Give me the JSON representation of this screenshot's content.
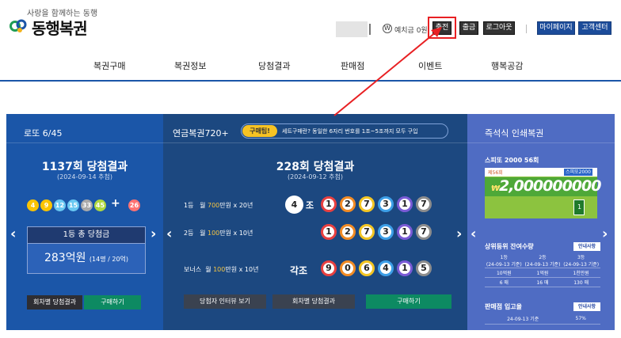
{
  "header": {
    "logo_sub": "사랑을 함께하는 동행",
    "logo_title": "동행복권",
    "deposit_icon": "W",
    "deposit_label": "예치금 0원",
    "charge": "충전",
    "withdraw": "출금",
    "logout": "로그아웃",
    "mypage": "마이페이지",
    "support": "고객센터",
    "highlight_color": "#e82023"
  },
  "nav": [
    "복권구매",
    "복권정보",
    "당첨결과",
    "판매점",
    "이벤트",
    "행복공감"
  ],
  "lotto": {
    "title": "로또 6/45",
    "round": "1137회 당첨결과",
    "date": "(2024-09-14 추첨)",
    "balls": [
      {
        "n": "4",
        "color": "#fbc400"
      },
      {
        "n": "9",
        "color": "#fbc400"
      },
      {
        "n": "12",
        "color": "#69c8f2"
      },
      {
        "n": "15",
        "color": "#69c8f2"
      },
      {
        "n": "33",
        "color": "#aaaaaa"
      },
      {
        "n": "45",
        "color": "#b0d840"
      }
    ],
    "plus": "+",
    "bonus": {
      "n": "26",
      "color": "#ff7272"
    },
    "prize_label": "1등 총 당첨금",
    "amount": "283억원",
    "amount_detail": "(14명 / 20억)",
    "btn_results": "회차별 당첨결과",
    "btn_buy": "구매하기"
  },
  "pension": {
    "title": "연금복권720+",
    "tip_tag": "구매팁!",
    "tip_text": "세트구매란? 동일한 6자리 번호를 1조~5조까지 모두 구입",
    "round": "228회 당첨결과",
    "date": "(2024-09-12 추첨)",
    "rank1": {
      "rank": "1등",
      "pre": "월 ",
      "amt": "700",
      "post": "만원 x 20년"
    },
    "rank2": {
      "rank": "2등",
      "pre": "월 ",
      "amt": "100",
      "post": "만원 x 10년"
    },
    "rank_bonus": {
      "rank": "보너스",
      "pre": "월 ",
      "amt": "100",
      "post": "만원 x 10년"
    },
    "jo_num": "4",
    "jo": "조",
    "gakjo": "각조",
    "digits1": [
      "1",
      "2",
      "7",
      "3",
      "1",
      "7"
    ],
    "digits2": [
      "1",
      "2",
      "7",
      "3",
      "1",
      "7"
    ],
    "digits_bonus": [
      "9",
      "0",
      "6",
      "4",
      "1",
      "5"
    ],
    "digit_colors": [
      "#e94040",
      "#f28b24",
      "#f3c523",
      "#3d9fe8",
      "#7a5bd6",
      "#8d8d8d"
    ],
    "btn_review": "당첨자 인터뷰 보기",
    "btn_results": "회차별 당첨결과",
    "btn_buy": "구매하기"
  },
  "instant": {
    "title": "즉석식 인쇄복권",
    "product": "스피또 2000 56회",
    "ticket_no": "제56회",
    "ticket_brand": "스피또2000",
    "ticket_amount": "2,000000000",
    "ticket_prefix": "₩",
    "ticket_box": "1",
    "remain_title": "상위등위 잔여수량",
    "remain_help": "안내사항",
    "cols": [
      "1등",
      "2등",
      "3등"
    ],
    "cols_date": [
      "(24-09-13 기준)",
      "(24-09-13 기준)",
      "(24-09-13 기준)"
    ],
    "prizes": [
      "10억원",
      "1억원",
      "1천만원"
    ],
    "counts": [
      "6 매",
      "16 매",
      "130 매"
    ],
    "ship_title": "판매점 입고율",
    "ship_help": "안내사항",
    "ship_date": "24-09-13 기준",
    "ship_rate": "57%"
  }
}
